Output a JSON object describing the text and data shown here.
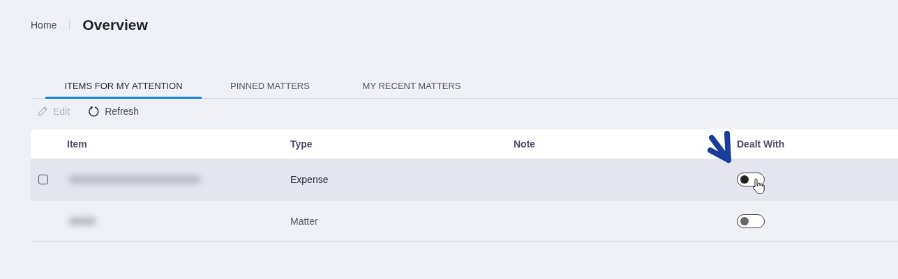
{
  "breadcrumb": {
    "home": "Home",
    "title": "Overview"
  },
  "tabs": [
    {
      "label": "ITEMS FOR MY ATTENTION",
      "selected": true
    },
    {
      "label": "PINNED MATTERS",
      "selected": false
    },
    {
      "label": "MY RECENT MATTERS",
      "selected": false
    }
  ],
  "toolbar": [
    {
      "label": "Edit",
      "kind": "edit",
      "disabled": true
    },
    {
      "label": "Refresh",
      "kind": "refresh",
      "disabled": false
    }
  ],
  "table": {
    "columns": [
      "Item",
      "Type",
      "Note",
      "Dealt With"
    ],
    "rows": [
      {
        "highlighted": true,
        "checked": false,
        "item": {
          "kind": "redacted"
        },
        "type": "Expense",
        "dealt_with": false
      },
      {
        "highlighted": false,
        "item": {
          "kind": "redacted"
        },
        "type": "Matter",
        "dealt_with": false
      }
    ]
  }
}
